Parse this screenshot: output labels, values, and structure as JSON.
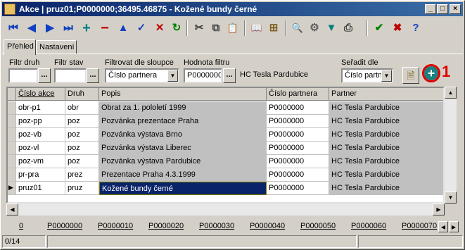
{
  "window": {
    "title": "Akce | pruz01;P0000000;36495.46875 - Kožené bundy černé",
    "minimize": "_",
    "maximize": "□",
    "close": "×"
  },
  "toolbar": {
    "first": "⏮",
    "prev": "◀",
    "next": "▶",
    "last": "⏭",
    "add": "+",
    "delete": "−",
    "up": "▲",
    "confirm": "✓",
    "cancel": "✕",
    "refresh": "↻",
    "cut": "✂",
    "copy": "⧉",
    "paste": "📋",
    "book": "📖",
    "tree": "⊞",
    "search": "🔍",
    "settings": "⚙",
    "filter": "▼",
    "print": "⎙",
    "ok": "✔",
    "close": "✖",
    "help": "?"
  },
  "toolbar_colors": {
    "blue": "#1040c0",
    "red": "#c00000",
    "green": "#008000",
    "teal": "#008080"
  },
  "tabs": [
    {
      "label": "Přehled"
    },
    {
      "label": "Nastavení"
    }
  ],
  "filters": {
    "druh_label": "Filtr druh",
    "druh_value": "",
    "stav_label": "Filtr stav",
    "stav_value": "",
    "column_label": "Filtrovat dle sloupce",
    "column_value": "Číslo partnera",
    "value_label": "Hodnota filtru",
    "value_value": "P0000000",
    "value_desc": "HC Tesla Pardubice",
    "sort_label": "Seřadit dle",
    "sort_value": "Číslo partn",
    "ellipsis": "..."
  },
  "annotation": {
    "number": "1"
  },
  "grid": {
    "headers": [
      "Číslo akce",
      "Druh",
      "Popis",
      "Číslo partnera",
      "Partner"
    ],
    "rows": [
      [
        "obr-p1",
        "obr",
        "Obrat za 1. pololetí 1999",
        "P0000000",
        "HC Tesla Pardubice"
      ],
      [
        "poz-pp",
        "poz",
        "Pozvánka prezentace Praha",
        "P0000000",
        "HC Tesla Pardubice"
      ],
      [
        "poz-vb",
        "poz",
        "Pozvánka výstava Brno",
        "P0000000",
        "HC Tesla Pardubice"
      ],
      [
        "poz-vl",
        "poz",
        "Pozvánka výstava Liberec",
        "P0000000",
        "HC Tesla Pardubice"
      ],
      [
        "poz-vm",
        "poz",
        "Pozvánka výstava Pardubice",
        "P0000000",
        "HC Tesla Pardubice"
      ],
      [
        "pr-pra",
        "prez",
        "Prezentace Praha 4.3.1999",
        "P0000000",
        "HC Tesla Pardubice"
      ],
      [
        "pruz01",
        "pruz",
        "Kožené bundy černé",
        "P0000000",
        "HC Tesla Pardubice"
      ]
    ],
    "current_row_marker": "▶"
  },
  "nav": {
    "links": [
      "0",
      "P0000000",
      "P0000010",
      "P0000020",
      "P0000030",
      "P0000040",
      "P0000050",
      "P0000060",
      "P0000070"
    ],
    "left": "◀",
    "right": "▶"
  },
  "status": {
    "record": "0/14",
    "field2": "",
    "field3": ""
  }
}
